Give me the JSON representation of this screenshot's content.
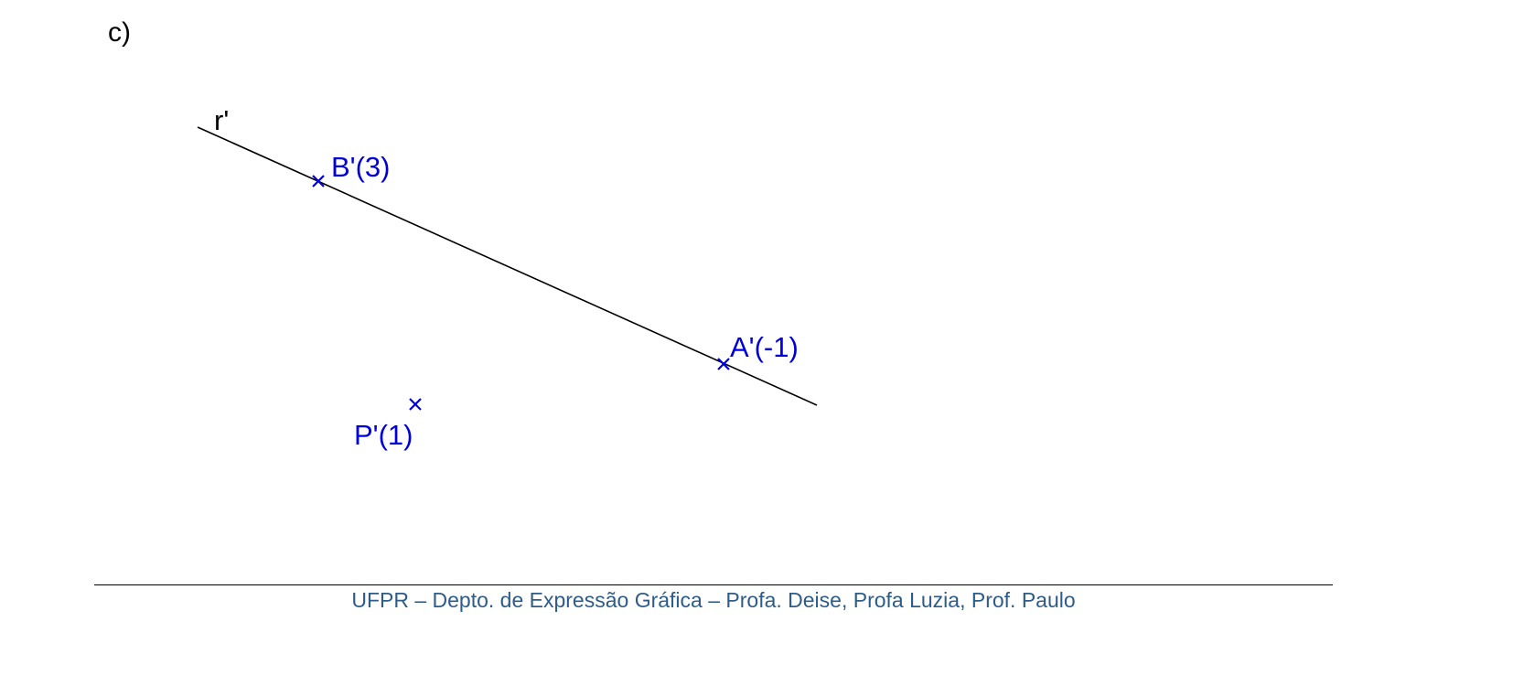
{
  "item_label": "c)",
  "line": {
    "label": "r'",
    "color": "#000000"
  },
  "points": [
    {
      "id": "B",
      "label": "B'(3)",
      "on_line": true
    },
    {
      "id": "A",
      "label": "A'(-1)",
      "on_line": true
    },
    {
      "id": "P",
      "label": "P'(1)",
      "on_line": false
    }
  ],
  "point_color": "#0000dd",
  "footer": {
    "text": "UFPR – Depto. de Expressão Gráfica – Profa. Deise, Profa Luzia, Prof. Paulo",
    "color": "#2e5c8a"
  }
}
